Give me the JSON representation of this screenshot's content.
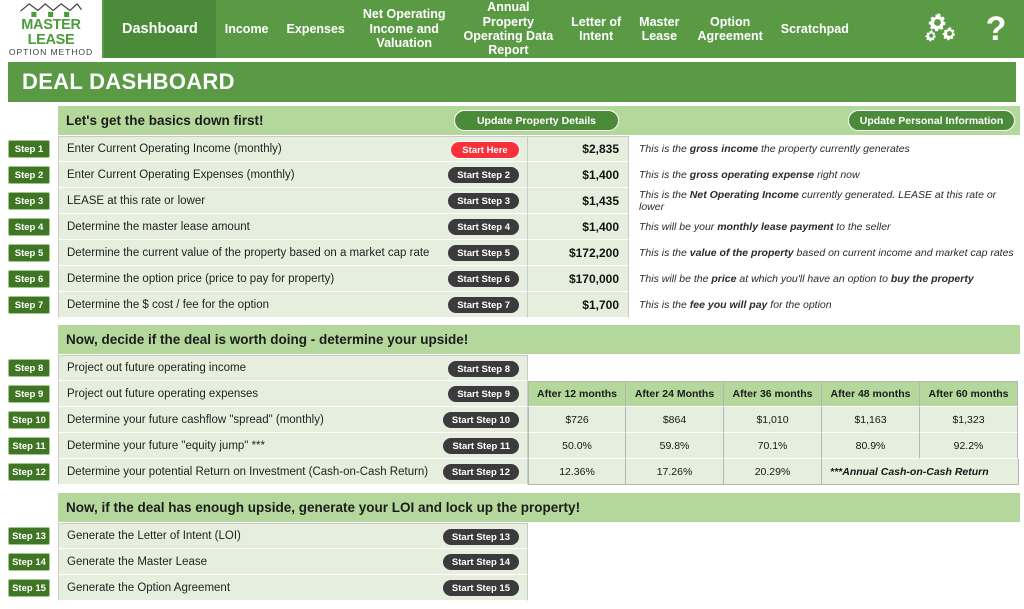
{
  "brand": {
    "name_line1": "MASTER LEASE",
    "name_line2": "OPTION METHOD"
  },
  "nav": {
    "tabs": [
      {
        "label": "Dashboard",
        "active": true
      },
      {
        "label": "Income",
        "active": false
      },
      {
        "label": "Expenses",
        "active": false
      },
      {
        "label": "Net Operating\nIncome and\nValuation",
        "active": false
      },
      {
        "label": "Annual\nProperty\nOperating Data\nReport",
        "active": false
      },
      {
        "label": "Letter of\nIntent",
        "active": false
      },
      {
        "label": "Master\nLease",
        "active": false
      },
      {
        "label": "Option\nAgreement",
        "active": false
      },
      {
        "label": "Scratchpad",
        "active": false
      }
    ],
    "icons": [
      "gears-icon",
      "help-question-icon"
    ],
    "bar_color": "#5a9a45",
    "active_tab_color": "#4a8a38"
  },
  "page_title": "DEAL DASHBOARD",
  "sections": [
    {
      "heading": "Let's get the basics down first!",
      "buttons": [
        {
          "label": "Update Property Details",
          "name": "update-property-details-button"
        },
        {
          "label": "Update Personal Information",
          "name": "update-personal-information-button"
        }
      ]
    },
    {
      "heading": "Now, decide if the deal is worth doing - determine your upside!",
      "buttons": []
    },
    {
      "heading": "Now, if the deal has enough upside, generate your LOI and lock up the property!",
      "buttons": []
    }
  ],
  "steps_basics": [
    {
      "step": "Step 1",
      "label": "Enter Current Operating Income (monthly)",
      "button": "Start Here",
      "button_style": "red",
      "value": "$2,835",
      "desc_pre": "This is the ",
      "desc_bold": "gross income",
      "desc_post": " the property currently generates"
    },
    {
      "step": "Step 2",
      "label": "Enter Current Operating Expenses (monthly)",
      "button": "Start Step 2",
      "button_style": "dark",
      "value": "$1,400",
      "desc_pre": "This is the ",
      "desc_bold": "gross operating expense",
      "desc_post": " right now"
    },
    {
      "step": "Step 3",
      "label": "LEASE at this rate or lower",
      "button": "Start Step 3",
      "button_style": "dark",
      "value": "$1,435",
      "desc_pre": "This is the ",
      "desc_bold": "Net Operating Income",
      "desc_post": " currently generated.  LEASE at this rate or lower"
    },
    {
      "step": "Step 4",
      "label": "Determine the master lease amount",
      "button": "Start Step 4",
      "button_style": "dark",
      "value": "$1,400",
      "desc_pre": "This will be your ",
      "desc_bold": "monthly lease payment",
      "desc_post": " to the seller"
    },
    {
      "step": "Step 5",
      "label": "Determine the current value of the property based on a market cap rate",
      "button": "Start Step 5",
      "button_style": "dark",
      "value": "$172,200",
      "desc_pre": "This is the ",
      "desc_bold": "value of the property",
      "desc_post": " based on current income and market cap rates"
    },
    {
      "step": "Step 6",
      "label": "Determine the option price (price to pay for property)",
      "button": "Start Step 6",
      "button_style": "dark",
      "value": "$170,000",
      "desc_pre": "This will be the ",
      "desc_bold": "price",
      "desc_post": " at which you'll have an option to ",
      "desc_bold2": "buy the property"
    },
    {
      "step": "Step 7",
      "label": "Determine the $ cost / fee for the option",
      "button": "Start Step 7",
      "button_style": "dark",
      "value": "$1,700",
      "desc_pre": "This is the ",
      "desc_bold": "fee you will pay",
      "desc_post": " for the option"
    }
  ],
  "steps_upside": [
    {
      "step": "Step 8",
      "label": "Project out future operating income",
      "button": "Start Step 8"
    },
    {
      "step": "Step 9",
      "label": "Project out future operating expenses",
      "button": "Start Step 9"
    },
    {
      "step": "Step 10",
      "label": "Determine your future cashflow \"spread\"  (monthly)",
      "button": "Start Step 10"
    },
    {
      "step": "Step 11",
      "label": "Determine your future \"equity jump\" ***",
      "button": "Start Step 11"
    },
    {
      "step": "Step 12",
      "label": "Determine your potential Return on Investment (Cash-on-Cash Return)",
      "button": "Start Step 12"
    }
  ],
  "projection_table": {
    "columns": [
      "After 12 months",
      "After 24 Months",
      "After 36 months",
      "After 48 months",
      "After 60 months"
    ],
    "rows": [
      {
        "row_label": "Determine your future cashflow \"spread\"  (monthly)",
        "values": [
          "$726",
          "$864",
          "$1,010",
          "$1,163",
          "$1,323"
        ]
      },
      {
        "row_label": "Determine your future \"equity jump\" ***",
        "values": [
          "50.0%",
          "59.8%",
          "70.1%",
          "80.9%",
          "92.2%"
        ]
      },
      {
        "row_label": "Determine your potential Return on Investment (Cash-on-Cash Return)",
        "values": [
          "12.36%",
          "17.26%",
          "20.29%"
        ],
        "note": "***Annual Cash-on-Cash Return"
      }
    ]
  },
  "steps_generate": [
    {
      "step": "Step 13",
      "label": "Generate the Letter of Intent (LOI)",
      "button": "Start Step 13"
    },
    {
      "step": "Step 14",
      "label": "Generate the Master Lease",
      "button": "Start Step 14"
    },
    {
      "step": "Step 15",
      "label": "Generate the Option Agreement",
      "button": "Start Step 15"
    }
  ],
  "colors": {
    "brand_green": "#5a9a45",
    "section_band": "#b4d89b",
    "row_fill": "#e6efdd",
    "step_badge": "#3f7524",
    "start_button": "#3b3b3b",
    "start_here_button": "#f92f3a"
  }
}
